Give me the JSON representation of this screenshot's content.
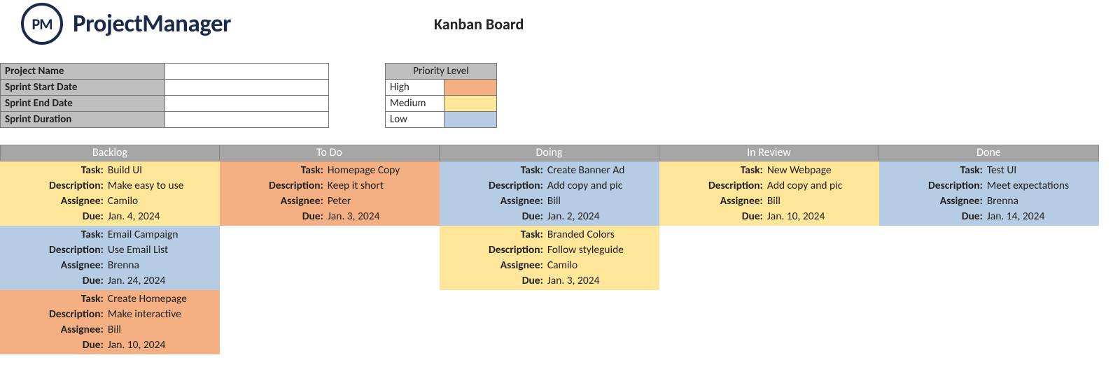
{
  "brand": {
    "logo_initials": "PM",
    "logo_text": "ProjectManager"
  },
  "title": "Kanban Board",
  "info_fields": [
    {
      "label": "Project Name",
      "value": ""
    },
    {
      "label": "Sprint Start Date",
      "value": ""
    },
    {
      "label": "Sprint End Date",
      "value": ""
    },
    {
      "label": "Sprint Duration",
      "value": ""
    }
  ],
  "legend": {
    "header": "Priority Level",
    "levels": [
      {
        "name": "High",
        "class": "bg-high"
      },
      {
        "name": "Medium",
        "class": "bg-medium"
      },
      {
        "name": "Low",
        "class": "bg-low"
      }
    ]
  },
  "card_field_labels": {
    "task": "Task:",
    "description": "Description:",
    "assignee": "Assignee:",
    "due": "Due:"
  },
  "columns": [
    {
      "name": "Backlog",
      "cards": [
        {
          "priority": "Medium",
          "task": "Build UI",
          "description": "Make easy to use",
          "assignee": "Camilo",
          "due": "Jan. 4, 2024"
        },
        {
          "priority": "Low",
          "task": "Email Campaign",
          "description": "Use Email List",
          "assignee": "Brenna",
          "due": "Jan. 24, 2024"
        },
        {
          "priority": "High",
          "task": "Create Homepage",
          "description": "Make interactive",
          "assignee": "Bill",
          "due": "Jan. 10, 2024"
        }
      ]
    },
    {
      "name": "To Do",
      "cards": [
        {
          "priority": "High",
          "task": "Homepage Copy",
          "description": "Keep it short",
          "assignee": "Peter",
          "due": "Jan. 3, 2024"
        }
      ]
    },
    {
      "name": "Doing",
      "cards": [
        {
          "priority": "Low",
          "task": "Create Banner Ad",
          "description": "Add copy and pic",
          "assignee": "Bill",
          "due": "Jan. 2, 2024"
        },
        {
          "priority": "Medium",
          "task": "Branded Colors",
          "description": "Follow styleguide",
          "assignee": "Camilo",
          "due": "Jan. 3, 2024"
        }
      ]
    },
    {
      "name": "In Review",
      "cards": [
        {
          "priority": "Medium",
          "task": "New Webpage",
          "description": "Add copy and pic",
          "assignee": "Bill",
          "due": "Jan. 10, 2024"
        }
      ]
    },
    {
      "name": "Done",
      "cards": [
        {
          "priority": "Low",
          "task": "Test UI",
          "description": "Meet expectations",
          "assignee": "Brenna",
          "due": "Jan. 14, 2024"
        }
      ]
    }
  ]
}
